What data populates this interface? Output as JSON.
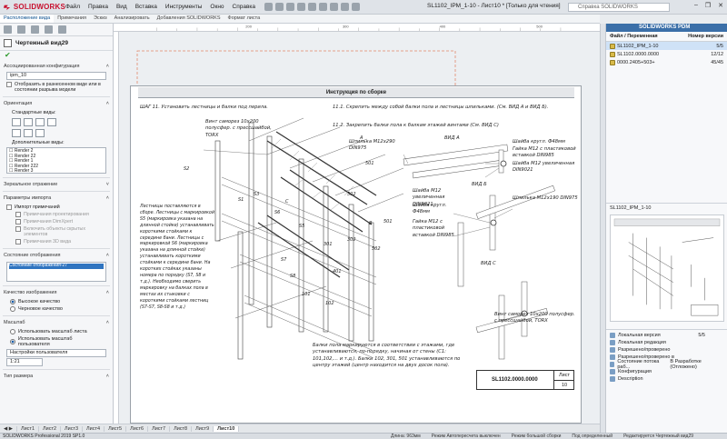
{
  "app": {
    "brand": "SOLIDWORKS",
    "title": "SL1102_IPM_1-10 - Лист10 * [Только для чтения]",
    "help_search": "Справка SOLIDWORKS",
    "version": "SOLIDWORKS Professional 2019 SP1.0"
  },
  "menu": [
    "Файл",
    "Правка",
    "Вид",
    "Вставка",
    "Инструменты",
    "Окно",
    "Справка"
  ],
  "command_tabs": [
    "Расположение вида",
    "Примечания",
    "Эскиз",
    "Анализировать",
    "Добавления SOLIDWORKS",
    "Формат листа"
  ],
  "ruler": {
    "marks": [
      "200",
      "300",
      "400",
      "500"
    ]
  },
  "property_manager": {
    "title": "Чертежный вид29",
    "sections": {
      "config": {
        "label": "Ассоциированная конфигурация",
        "value": "ipm_10",
        "check": "Отобразить в разнесенном виде или в состоянии разрыва модели"
      },
      "orientation": {
        "label": "Ориентация",
        "standard_views": "Стандартные виды:",
        "more_views": "Дополнительные виды:",
        "views_list": [
          "Render 2",
          "Render 22",
          "Render 1",
          "Render 222",
          "Render 3"
        ]
      },
      "mirror": {
        "label": "Зеркальное отражение"
      },
      "import": {
        "label": "Параметры импорта",
        "import_notes": "Импорт примечаний",
        "design_notes": "Примечания проектирования",
        "dimxpert": "Примечания DimXpert",
        "hidden": "Включить объекты скрытых элементов",
        "notes_3d": "Примечания 3D вида"
      },
      "display_state": {
        "label": "Состояние отображения",
        "value": "Состояние отображения-27"
      },
      "quality": {
        "label": "Качество изображения",
        "high": "Высокое качество",
        "draft": "Черновое качество"
      },
      "scale": {
        "label": "Масштаб",
        "sheet": "Использовать масштаб листа",
        "user": "Использовать масштаб пользователя",
        "preset": "Настройки пользователя",
        "value": "1:21"
      },
      "dims": {
        "label": "Тип размера"
      }
    }
  },
  "sheet": {
    "header": "Инструкция по сборке",
    "step": "ШАГ 11. Установить лестницы и балки под перила.",
    "note_screw_top": "Винт саморез 10х200 полусфер. с прессшайбой, TORX",
    "note_11_1": "11.1. Скрепить между собой балки пола и лестницы шпильками. (См. ВИД А и ВИД Б).",
    "note_11_2": "11.2. Закрепить балки пола к балкам этажей винтами (См. ВИД С)",
    "view_a": "ВИД А",
    "view_b": "ВИД Б",
    "view_c": "ВИД С",
    "stud_m12": "Шпилька M12х290 DIN975",
    "washer_48": "Шайба кругл. Ф48мм",
    "nut_m12_a": "Гайка M12 с пластиковой вставкой DIN985",
    "washer_m12": "Шайба M12 увеличенная DIN9021",
    "washer_m12_b": "Шайба M12 увеличенная DIN9021",
    "washer_48_b": "Шайба кругл. Ф48мм",
    "nut_m12_b": "Гайка M12 с пластиковой вставкой DIN985",
    "stud_m12_b": "Шпилька M12х190 DIN975",
    "note_screw_c": "Винт саморез 10х200 полусфер. с прессшайбой, TORX",
    "left_note": "Лестницы поставляются в сборе. Лестницы с маркировкой S5 (маркировка указана на длинной стойке) устанавливать короткими стойками к середине бани. Лестницы с маркировкой S6 (маркировка указана на длинной стойке) устанавливать короткими стойками к середине бани. На коротких стойках указаны номера по порядку (S7, S8 и т.д.). Необходимо сверить маркировку на балках пола в местах их стыковки с короткими стойками лестниц (S7-S7, S8-S8 и т.д.)",
    "bottom_note": "Балки пола маркируются в соответствии с этажами, где устанавливаются, по-порядку, начиная от стены (С1: 101,102,... и т.д.). Балки 102, 301, 501 устанавливаются по центру этажей (центр находится на двух досок пола).",
    "labels": [
      "S2",
      "S1",
      "S3",
      "S6",
      "S5",
      "S7",
      "S8",
      "301",
      "302",
      "101",
      "102",
      "502",
      "502",
      "501",
      "501",
      "401",
      "A",
      "B",
      "C"
    ],
    "stamp_code": "SL1102.0000.0000",
    "stamp_sheet_label": "Лист",
    "stamp_sheet_no": "10"
  },
  "sheet_tabs": [
    "Лист1",
    "Лист2",
    "Лист3",
    "Лист4",
    "Лист5",
    "Лист6",
    "Лист7",
    "Лист8",
    "Лист9",
    "Лист10"
  ],
  "status": [
    "Длина: 963мм",
    "Режим Автопересчета выключен",
    "Режим большой сборки",
    "Под определенный",
    "Редактируется Чертежный вид29"
  ],
  "pdm": {
    "title": "SOLIDWORKS PDM",
    "col_name": "Файл / Переменная",
    "col_version": "Номер версии",
    "rows": [
      {
        "name": "SL1102_IPM_1-10",
        "version": "5/5"
      },
      {
        "name": "SL1102.0000.0000",
        "version": "12/12"
      },
      {
        "name": "0000.2405+503+",
        "version": "45/45"
      }
    ],
    "preview_label": "SL1102_IPM_1-10",
    "props": [
      {
        "label": "Локальная версия",
        "value": "5/5"
      },
      {
        "label": "Локальная редакция",
        "value": ""
      },
      {
        "label": "Разрешено/проверено",
        "value": ""
      },
      {
        "label": "Разрешено/проверено в",
        "value": ""
      },
      {
        "label": "Состояние потока раб...",
        "value": "В Разработке (Отложено)"
      },
      {
        "label": "Конфигурация",
        "value": ""
      },
      {
        "label": "Description",
        "value": ""
      }
    ]
  }
}
